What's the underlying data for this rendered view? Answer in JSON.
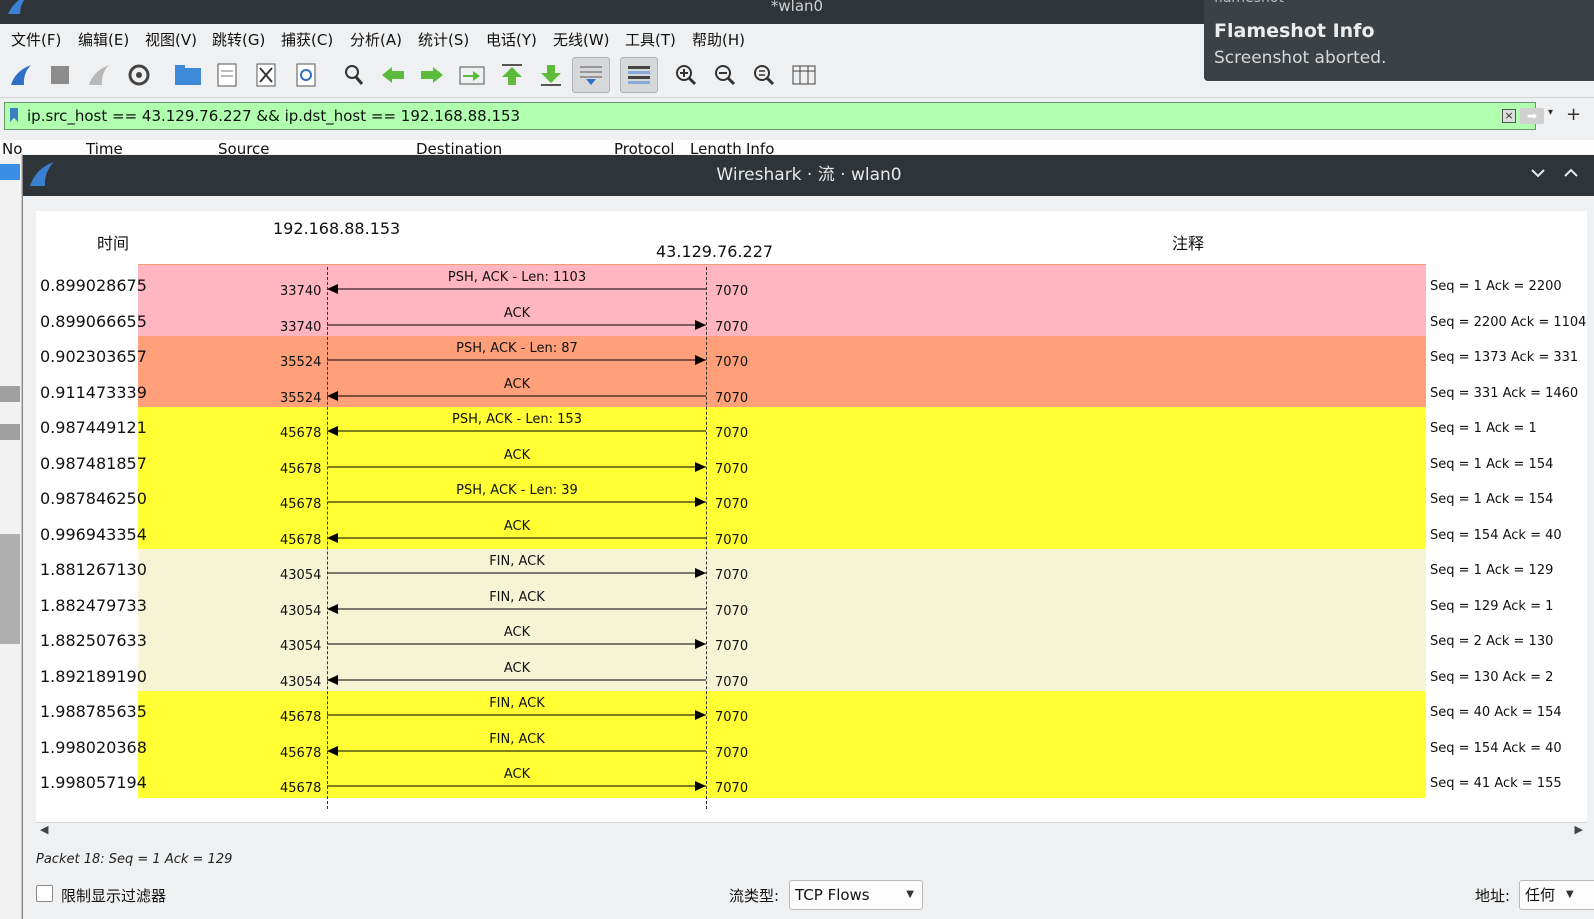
{
  "window": {
    "title": "*wlan0"
  },
  "menu": [
    "文件(F)",
    "编辑(E)",
    "视图(V)",
    "跳转(G)",
    "捕获(C)",
    "分析(A)",
    "统计(S)",
    "电话(Y)",
    "无线(W)",
    "工具(T)",
    "帮助(H)"
  ],
  "toolbar": {
    "icons": [
      "shark-fin-start-icon",
      "stop-square-icon",
      "restart-fin-icon",
      "capture-options-gear-icon",
      "open-folder-icon",
      "save-file-icon",
      "close-file-icon",
      "reload-icon",
      "find-magnifier-icon",
      "go-back-arrow-icon",
      "go-forward-arrow-icon",
      "go-to-packet-icon",
      "first-packet-icon",
      "last-packet-icon",
      "autoscroll-icon",
      "colorize-icon",
      "zoom-in-icon",
      "zoom-out-icon",
      "zoom-reset-icon",
      "resize-columns-icon"
    ],
    "pressed": [
      "autoscroll-icon",
      "colorize-icon"
    ]
  },
  "filter": {
    "value": "ip.src_host == 43.129.76.227 && ip.dst_host == 192.168.88.153",
    "color": "#afffaf"
  },
  "packet_list_header": [
    "No",
    "Time",
    "Source",
    "Destination",
    "Protocol",
    "Length",
    "Info"
  ],
  "notification": {
    "app": "flameshot",
    "title": "Flameshot Info",
    "body": "Screenshot aborted."
  },
  "dialog": {
    "title": "Wireshark · 流 · wlan0",
    "col_time": "时间",
    "col_comment": "注释",
    "host_a": "192.168.88.153",
    "host_b": "43.129.76.227",
    "rows": [
      {
        "time": "0.899028675",
        "sport": "33740",
        "dport": "7070",
        "label": "PSH, ACK - Len: 1103",
        "dir": "left",
        "comment": "Seq = 1 Ack = 2200",
        "color": "#ffb6c1"
      },
      {
        "time": "0.899066655",
        "sport": "33740",
        "dport": "7070",
        "label": "ACK",
        "dir": "right",
        "comment": "Seq = 2200 Ack = 1104",
        "color": "#ffb6c1"
      },
      {
        "time": "0.902303657",
        "sport": "35524",
        "dport": "7070",
        "label": "PSH, ACK - Len: 87",
        "dir": "right",
        "comment": "Seq = 1373 Ack = 331",
        "color": "#ffa07a"
      },
      {
        "time": "0.911473339",
        "sport": "35524",
        "dport": "7070",
        "label": "ACK",
        "dir": "left",
        "comment": "Seq = 331 Ack = 1460",
        "color": "#ffa07a"
      },
      {
        "time": "0.987449121",
        "sport": "45678",
        "dport": "7070",
        "label": "PSH, ACK - Len: 153",
        "dir": "left",
        "comment": "Seq = 1 Ack = 1",
        "color": "#ffff33"
      },
      {
        "time": "0.987481857",
        "sport": "45678",
        "dport": "7070",
        "label": "ACK",
        "dir": "right",
        "comment": "Seq = 1 Ack = 154",
        "color": "#ffff33"
      },
      {
        "time": "0.987846250",
        "sport": "45678",
        "dport": "7070",
        "label": "PSH, ACK - Len: 39",
        "dir": "right",
        "comment": "Seq = 1 Ack = 154",
        "color": "#ffff33"
      },
      {
        "time": "0.996943354",
        "sport": "45678",
        "dport": "7070",
        "label": "ACK",
        "dir": "left",
        "comment": "Seq = 154 Ack = 40",
        "color": "#ffff33"
      },
      {
        "time": "1.881267130",
        "sport": "43054",
        "dport": "7070",
        "label": "FIN, ACK",
        "dir": "right",
        "comment": "Seq = 1 Ack = 129",
        "color": "#f5f5d5"
      },
      {
        "time": "1.882479733",
        "sport": "43054",
        "dport": "7070",
        "label": "FIN, ACK",
        "dir": "left",
        "comment": "Seq = 129 Ack = 1",
        "color": "#f5f5d5"
      },
      {
        "time": "1.882507633",
        "sport": "43054",
        "dport": "7070",
        "label": "ACK",
        "dir": "right",
        "comment": "Seq = 2 Ack = 130",
        "color": "#f5f5d5"
      },
      {
        "time": "1.892189190",
        "sport": "43054",
        "dport": "7070",
        "label": "ACK",
        "dir": "left",
        "comment": "Seq = 130 Ack = 2",
        "color": "#f5f5d5"
      },
      {
        "time": "1.988785635",
        "sport": "45678",
        "dport": "7070",
        "label": "FIN, ACK",
        "dir": "right",
        "comment": "Seq = 40 Ack = 154",
        "color": "#ffff33"
      },
      {
        "time": "1.998020368",
        "sport": "45678",
        "dport": "7070",
        "label": "FIN, ACK",
        "dir": "left",
        "comment": "Seq = 154 Ack = 40",
        "color": "#ffff33"
      },
      {
        "time": "1.998057194",
        "sport": "45678",
        "dport": "7070",
        "label": "ACK",
        "dir": "right",
        "comment": "Seq = 41 Ack = 155",
        "color": "#ffff33"
      }
    ],
    "status": "Packet 18: Seq = 1 Ack = 129",
    "limit_filter_label": "限制显示过滤器",
    "flow_type_label": "流类型:",
    "flow_type_value": "TCP Flows",
    "address_label": "地址:",
    "address_value": "任何"
  }
}
